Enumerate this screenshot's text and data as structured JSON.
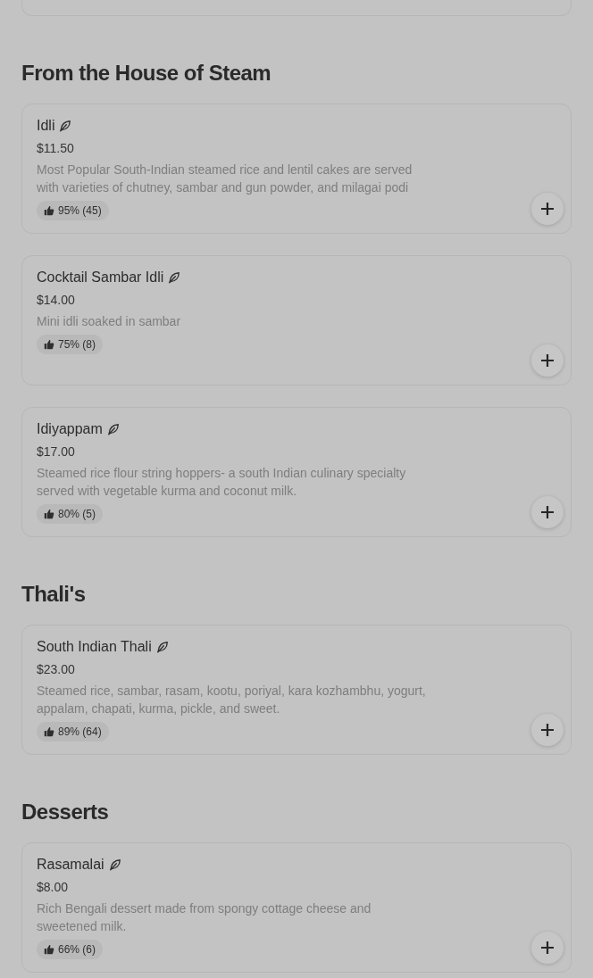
{
  "sections": [
    {
      "title": "From the House of Steam",
      "items": [
        {
          "name": "Idli",
          "vegetarian": true,
          "price": "$11.50",
          "description": "Most Popular South-Indian steamed rice and lentil cakes are served with varieties of chutney, sambar and gun powder, and milagai podi",
          "rating": "95% (45)"
        },
        {
          "name": "Cocktail Sambar Idli",
          "vegetarian": true,
          "price": "$14.00",
          "description": "Mini idli soaked in sambar",
          "rating": "75% (8)"
        },
        {
          "name": "Idiyappam",
          "vegetarian": true,
          "price": "$17.00",
          "description": "Steamed rice flour string hoppers- a south Indian culinary specialty served with vegetable kurma and coconut milk.",
          "rating": "80% (5)"
        }
      ]
    },
    {
      "title": "Thali's",
      "items": [
        {
          "name": "South Indian Thali",
          "vegetarian": true,
          "price": "$23.00",
          "description": "Steamed rice, sambar, rasam, kootu, poriyal, kara kozhambhu, yogurt, appalam, chapati, kurma, pickle, and sweet.",
          "rating": "89% (64)"
        }
      ]
    },
    {
      "title": "Desserts",
      "items": [
        {
          "name": "Rasamalai",
          "vegetarian": true,
          "price": "$8.00",
          "description": "Rich Bengali dessert made from spongy cottage cheese and sweetened milk.",
          "rating": "66% (6)"
        }
      ]
    }
  ]
}
